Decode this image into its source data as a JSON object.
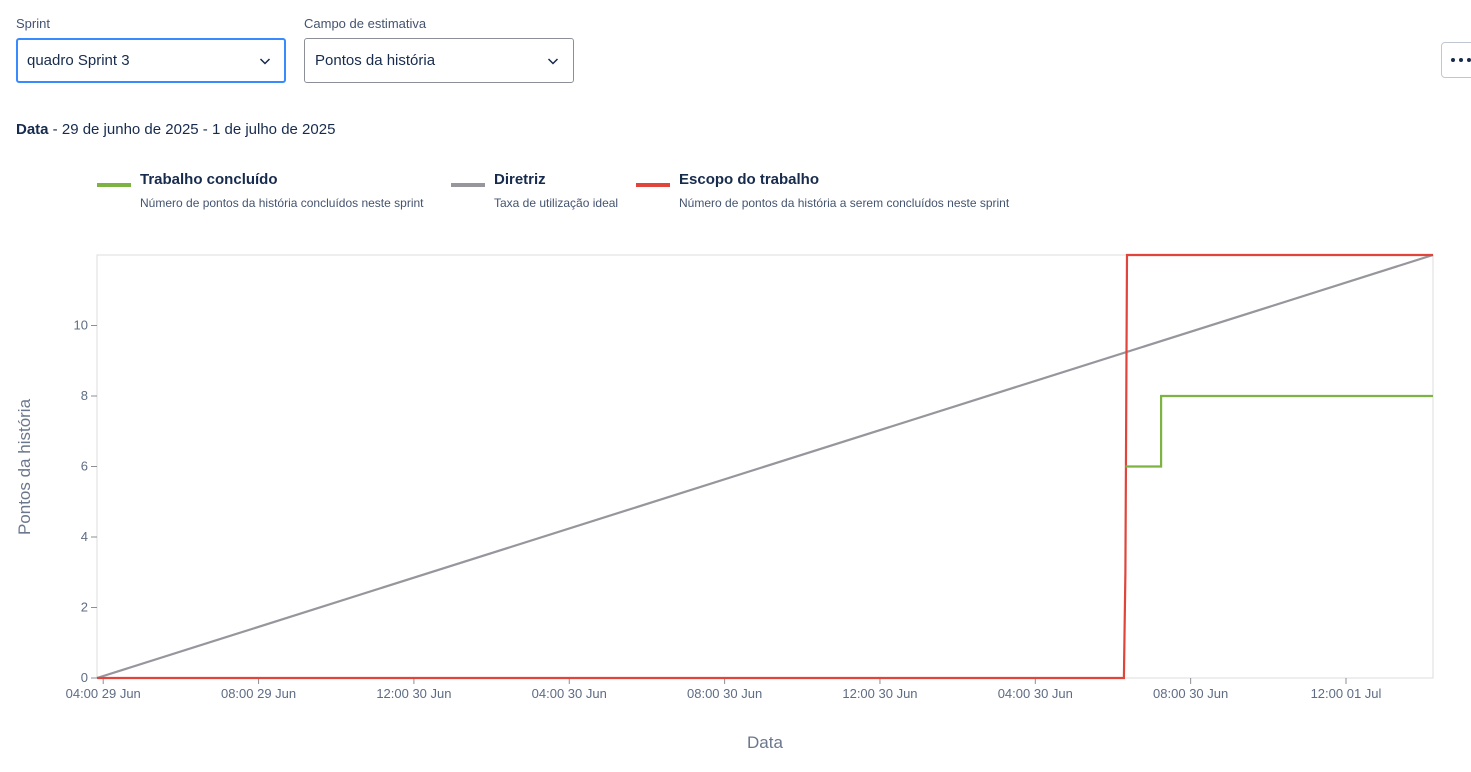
{
  "filters": {
    "sprint": {
      "label": "Sprint",
      "value": "quadro Sprint 3"
    },
    "estimate": {
      "label": "Campo de estimativa",
      "value": "Pontos da história"
    }
  },
  "date_range": {
    "label": "Data",
    "value": " - 29 de junho de 2025 - 1 de julho de 2025"
  },
  "legend": [
    {
      "title": "Trabalho concluído",
      "description": "Número de pontos da história concluídos neste sprint",
      "color": "#7cb342"
    },
    {
      "title": "Diretriz",
      "description": "Taxa de utilização ideal",
      "color": "#97969c"
    },
    {
      "title": "Escopo do trabalho",
      "description": "Número de pontos da história a serem concluídos neste sprint",
      "color": "#e0443a"
    }
  ],
  "icons": {
    "more": "more-horizontal-icon",
    "dropdown": "chevron-down-icon"
  },
  "chart_data": {
    "type": "line",
    "xlabel": "Data",
    "ylabel": "Pontos da história",
    "x_range_hours": [
      0,
      43
    ],
    "ylim": [
      0,
      12
    ],
    "y_ticks": [
      0,
      2,
      4,
      6,
      8,
      10
    ],
    "x_ticks": [
      {
        "h": 0.2,
        "label": "04:00 29 Jun"
      },
      {
        "h": 5.2,
        "label": "08:00 29 Jun"
      },
      {
        "h": 10.2,
        "label": "12:00 30 Jun"
      },
      {
        "h": 15.2,
        "label": "04:00 30 Jun"
      },
      {
        "h": 20.2,
        "label": "08:00 30 Jun"
      },
      {
        "h": 25.2,
        "label": "12:00 30 Jun"
      },
      {
        "h": 30.2,
        "label": "04:00 30 Jun"
      },
      {
        "h": 35.2,
        "label": "08:00 30 Jun"
      },
      {
        "h": 40.2,
        "label": "12:00 01 Jul"
      }
    ],
    "series": [
      {
        "name": "Diretriz",
        "color": "#97969c",
        "points": [
          [
            0,
            0
          ],
          [
            43,
            12
          ]
        ]
      },
      {
        "name": "Escopo do trabalho",
        "color": "#e0443a",
        "points": [
          [
            0,
            0
          ],
          [
            33.05,
            0
          ],
          [
            33.1,
            3
          ],
          [
            33.15,
            12
          ],
          [
            43,
            12
          ]
        ]
      },
      {
        "name": "Trabalho concluído",
        "color": "#7cb342",
        "points": [
          [
            33.1,
            6
          ],
          [
            34.25,
            6
          ],
          [
            34.25,
            8
          ],
          [
            43,
            8
          ]
        ]
      }
    ]
  }
}
